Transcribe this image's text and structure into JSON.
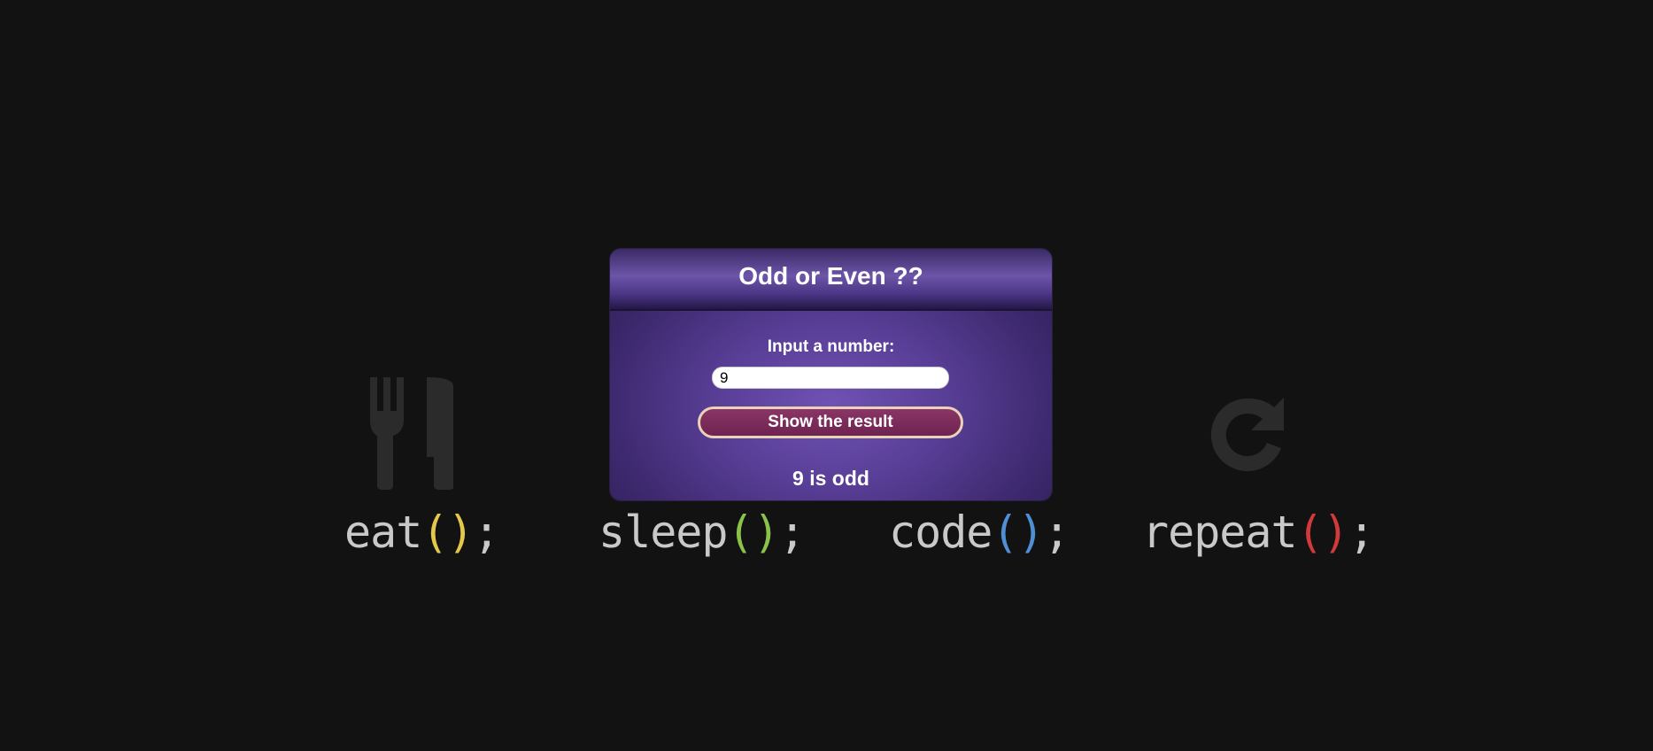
{
  "card": {
    "title": "Odd or Even ??",
    "prompt_label": "Input a number:",
    "input_value": "9",
    "button_label": "Show the result",
    "result_text": "9 is odd"
  },
  "wallpaper": {
    "words": [
      {
        "name": "eat",
        "paren_color": "#e4c84a"
      },
      {
        "name": "sleep",
        "paren_color": "#8bc34a"
      },
      {
        "name": "code",
        "paren_color": "#4f8fd6"
      },
      {
        "name": "repeat",
        "paren_color": "#d03a3a"
      }
    ],
    "paren_text": "()",
    "semicolon": ";",
    "icons": [
      "utensils-icon",
      "bed-icon",
      "code-icon",
      "repeat-icon"
    ],
    "icon_color": "#2b2b2b"
  },
  "colors": {
    "background": "#121212",
    "word_color": "#c9c9c9",
    "button_border": "#e8d2b8",
    "button_fill": "#7a2b5c"
  }
}
